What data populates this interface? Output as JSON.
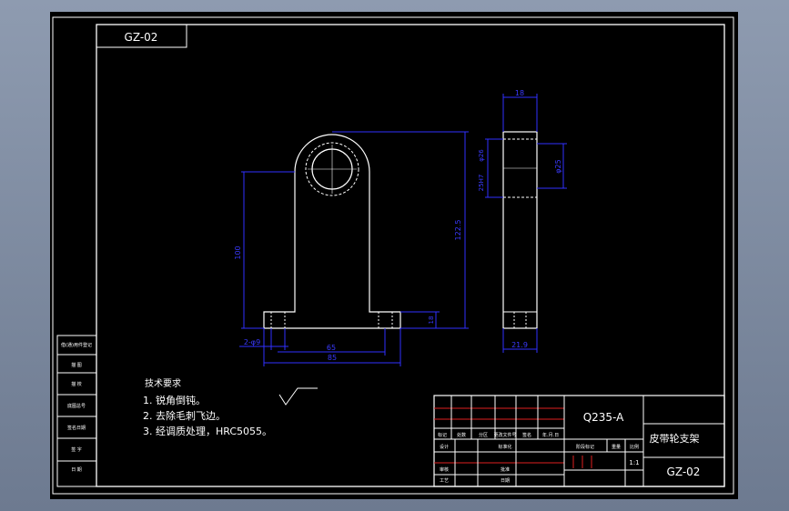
{
  "drawing": {
    "code_tag": "GZ-02",
    "material": "Q235-A",
    "part_name": "皮带轮支架",
    "drawing_no": "GZ-02",
    "scale": "1:1"
  },
  "dimensions": {
    "side_width": "18",
    "side_bore": "φ25",
    "side_hole_left": "φ26",
    "side_hole_left2": "25H7",
    "side_bottom": "21.9",
    "front_height": "100",
    "front_overall": "122.5",
    "base_thickness": "18",
    "base_holes": "2-φ9",
    "base_inner": "65",
    "base_outer": "85"
  },
  "notes": {
    "title": "技术要求",
    "items": [
      "1. 锐角倒钝。",
      "2. 去除毛刺飞边。",
      "3. 经调质处理，HRC5055。"
    ]
  },
  "left_strip": [
    "借(通)用件登记",
    "描 图",
    "描 校",
    "底图总号",
    "签名日期",
    "签 字",
    "日 期"
  ],
  "title_block": {
    "headers": [
      "标记",
      "处数",
      "分区",
      "更改文件号",
      "签名",
      "年.月.日"
    ],
    "row2": [
      "设计",
      "",
      "标准化"
    ],
    "stage_labels": [
      "阶段标记",
      "重量",
      "比例"
    ],
    "row_audit": [
      "审核",
      "",
      "",
      "批准"
    ],
    "row_process": [
      "工艺",
      "",
      "",
      "日期"
    ]
  }
}
